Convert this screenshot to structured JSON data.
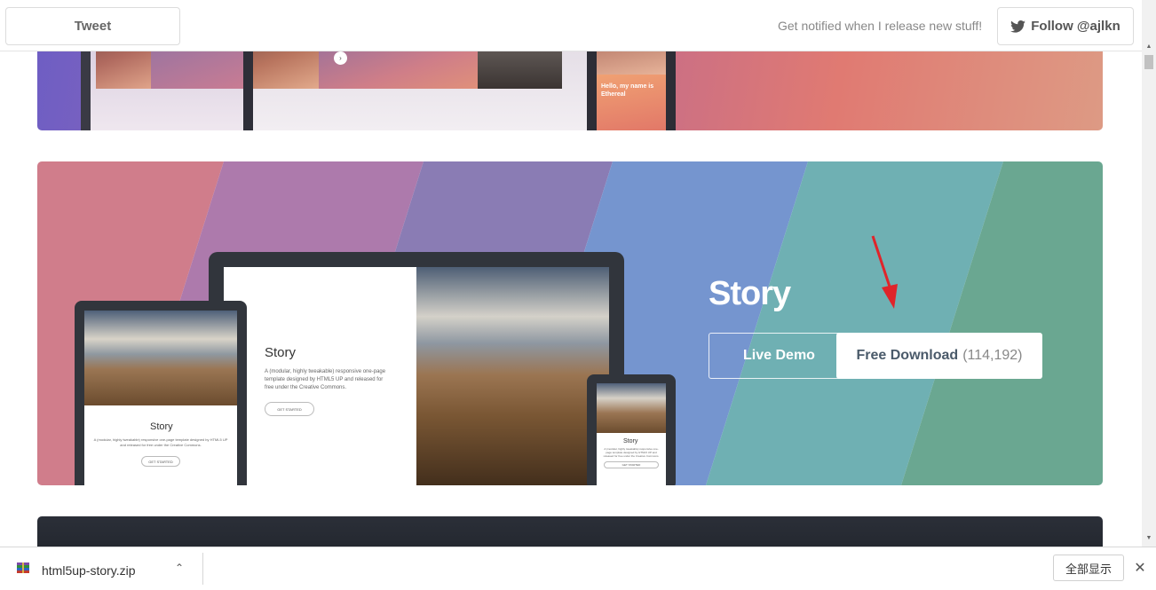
{
  "topbar": {
    "tweet_label": "Tweet",
    "notify_text": "Get notified when I release new stuff!",
    "follow_label": "Follow @ajlkn"
  },
  "card1": {
    "ethereal_heading": "Hello, my name is Ethereal"
  },
  "card2": {
    "title": "Story",
    "live_demo_label": "Live Demo",
    "free_download_label": "Free Download",
    "download_count": "(114,192)",
    "stripe_colors": [
      "#d07d8b",
      "#ad7aac",
      "#8a7cb4",
      "#7595cf",
      "#6fb0b3",
      "#6aa791"
    ],
    "mockup": {
      "heading": "Story",
      "description": "A (modular, highly tweakable) responsive one-page template designed by HTML5 UP and released for free under the Creative Commons.",
      "button_label": "GET STARTED"
    }
  },
  "download_bar": {
    "file_name": "html5up-story.zip",
    "show_all_label": "全部显示",
    "close_label": "✕"
  },
  "colors": {
    "accent_arrow": "#e0242a"
  }
}
